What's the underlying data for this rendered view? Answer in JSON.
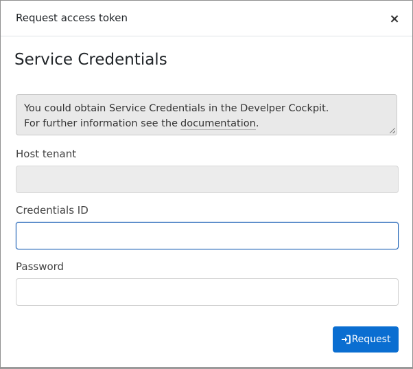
{
  "dialog": {
    "title": "Request access token",
    "close_symbol": "×",
    "close_icon": "close-icon"
  },
  "section": {
    "title": "Service Credentials"
  },
  "info": {
    "line1": "You could obtain Service Credentials in the Develper Cockpit.",
    "line2_prefix": "For further information see the",
    "link_text": "documentation",
    "line2_suffix": "."
  },
  "fields": {
    "host_tenant": {
      "label": "Host tenant",
      "value": ""
    },
    "credentials_id": {
      "label": "Credentials ID",
      "value": ""
    },
    "password": {
      "label": "Password",
      "value": ""
    }
  },
  "actions": {
    "request_label": "Request",
    "request_icon": "sign-in-icon"
  },
  "colors": {
    "primary": "#0a6ed1",
    "focus_border": "#1a5fb4",
    "readonly_bg": "#ececec"
  }
}
